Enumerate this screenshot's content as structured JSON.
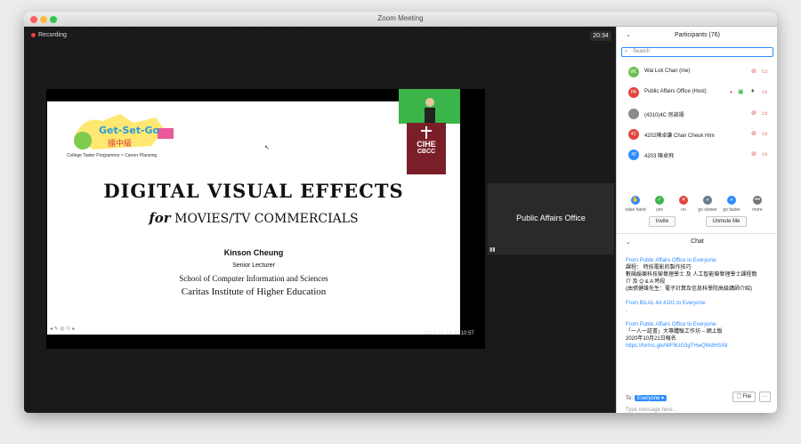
{
  "window": {
    "title": "Zoom Meeting"
  },
  "meeting": {
    "recording_label": "Recording",
    "timer": "20:34",
    "tile_name": "Public Affairs Office"
  },
  "slide": {
    "logo_text": "Get-Set-Go",
    "logo_chinese": "擂中級",
    "tagline": "College Taster Programme × Career Planning",
    "title": "DIGITAL VISUAL EFFECTS",
    "subtitle_for": "for",
    "subtitle_rest": "MOVIES/TV COMMERCIALS",
    "speaker": "Kinson Cheung",
    "speaker_title": "Senior Lecturer",
    "school": "School of Computer Information and Sciences",
    "institute": "Caritas Institute of Higher Education",
    "badge_line1": "CIHE",
    "badge_line2": "CBCC",
    "controls": "◂ ✎ ◎ ☉ ▸",
    "timestamp": "2020-04-16  12:10:57"
  },
  "panel": {
    "participants_title": "Participants (76)",
    "search_placeholder": "Search",
    "participants": [
      {
        "initials": "WL",
        "name": "Wai Lok Chan (me)",
        "color": "#6cbf4f"
      },
      {
        "initials": "PA",
        "name": "Public Affairs Office (Host)",
        "color": "#e0453c"
      },
      {
        "initials": "",
        "name": "(4310)4C 房啟揚",
        "color": "#8a8a8a"
      },
      {
        "initials": "4C",
        "name": "4202陳卓謙 Chan Cheuk Him",
        "color": "#e0453c"
      },
      {
        "initials": "42",
        "name": "4203 陳卓飛",
        "color": "#2d8cff"
      }
    ],
    "reactions": [
      {
        "label": "raise hand",
        "color": "#2d8cff",
        "glyph": "✋"
      },
      {
        "label": "yes",
        "color": "#3bb54a",
        "glyph": "✓"
      },
      {
        "label": "no",
        "color": "#e0453c",
        "glyph": "✕"
      },
      {
        "label": "go slower",
        "color": "#6c7a89",
        "glyph": "«"
      },
      {
        "label": "go faster",
        "color": "#2d8cff",
        "glyph": "»"
      },
      {
        "label": "more",
        "color": "#777777",
        "glyph": "•••"
      }
    ],
    "invite_label": "Invite",
    "unmute_label": "Unmute Me",
    "chat_title": "Chat",
    "messages": [
      {
        "from": "From Public Affairs Office to Everyone:",
        "lines": [
          "課程： 特技電影的製作技巧",
          "數碼娛樂科技榮譽理學士 及 人工智能榮譽理學士課程簡",
          "介 及 Q & A 時段",
          "(由張健雄先生：電子計算及信息科學院高級講師介紹)"
        ]
      },
      {
        "from": "From BILAL 4A 4101 to Everyone:",
        "lines": [
          "."
        ]
      },
      {
        "from": "From Public Affairs Office to Everyone:",
        "lines": [
          "「一人一証書」大專體驗工作坊 – 網上版",
          "2020年10月21日報名 "
        ],
        "link": "https://forms.gle/WF8UG3gTHwQWdHSX8"
      }
    ],
    "to_label": "To:",
    "to_value": "Everyone ▾",
    "file_label": "File",
    "more_label": "···",
    "type_placeholder": "Type message here..."
  },
  "colors": {
    "accent": "#2d8cff",
    "alert": "#e0453c",
    "slide_bg": "#ffffff",
    "cihe": "#7a1f2a",
    "webcam": "#3bb54a"
  }
}
